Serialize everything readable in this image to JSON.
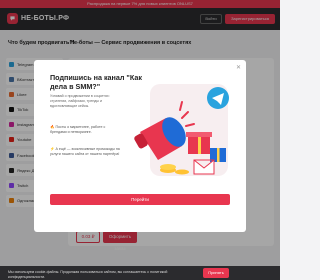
{
  "promo_bar": {
    "text": "Распродажа на первые 7% для новых клиентов ONLUS7"
  },
  "header": {
    "logo_text": "НЕ-БОТЫ.РФ",
    "login_label": "Войти",
    "register_label": "Зарегистрироваться"
  },
  "headings": {
    "left": "Что будем продвигать?!",
    "right": "Не-боты — Сервис продвижения в соцсетях"
  },
  "sidebar": {
    "items": [
      {
        "label": "Telegram",
        "color": "#2aa3de"
      },
      {
        "label": "ВКонтакте",
        "color": "#4a76a8"
      },
      {
        "label": "Likee",
        "color": "#ec6a2f"
      },
      {
        "label": "TikTok",
        "color": "#111111"
      },
      {
        "label": "Instagram",
        "color": "#d6249f"
      },
      {
        "label": "Youtube",
        "color": "#e62117"
      },
      {
        "label": "Facebook",
        "color": "#3b5998"
      },
      {
        "label": "Яндекс Дзен",
        "color": "#222222"
      },
      {
        "label": "Twitch",
        "color": "#9146ff"
      },
      {
        "label": "Одноклассники",
        "color": "#ee8208"
      }
    ]
  },
  "content": {
    "right_label": "платность"
  },
  "order": {
    "price_label": "0.03 ₽",
    "order_label": "Оформить заказ"
  },
  "modal": {
    "close_label": "✕",
    "title": "Подпишись на канал \"Как дела в SMM?\"",
    "description": "Узнавай о продвижении в соцсетях: стратегии, лайфхаки, тренды и вдохновляющие кейсы.",
    "bullet1": "🔥 Посты о маркетинге, работе с брендами и нетворкинге.",
    "bullet2": "⚡ А ещё — эксклюзивные промокоды на услуги нашего сайта от нашего партнёра!",
    "button_label": "Перейти",
    "accent": "#e8364f"
  },
  "cookie_bar": {
    "text": "Мы используем cookie-файлы. Продолжая пользоваться сайтом, вы соглашаетесь с политикой конфиденциальности.",
    "button_label": "Принять"
  }
}
